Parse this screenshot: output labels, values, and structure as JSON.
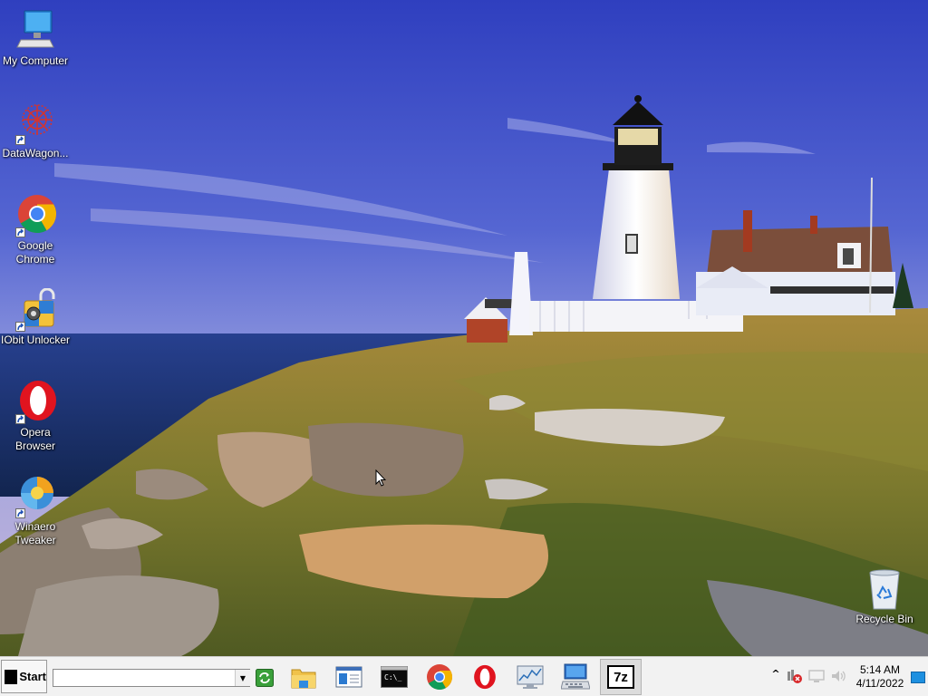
{
  "desktop": {
    "icons": [
      {
        "label": "My Computer",
        "icon": "computer-icon",
        "shortcut": false
      },
      {
        "label": "DataWagon...",
        "icon": "datawagon-icon",
        "shortcut": true
      },
      {
        "label": "Google Chrome",
        "icon": "chrome-icon",
        "shortcut": true
      },
      {
        "label": "IObit Unlocker",
        "icon": "iobit-unlocker-icon",
        "shortcut": true
      },
      {
        "label": "Opera Browser",
        "icon": "opera-icon",
        "shortcut": true
      },
      {
        "label": "Winaero Tweaker",
        "icon": "winaero-icon",
        "shortcut": true
      },
      {
        "label": "Recycle Bin",
        "icon": "recycle-bin-icon",
        "shortcut": false
      }
    ],
    "wallpaper": "lighthouse-coast-wallpaper"
  },
  "taskbar": {
    "start_label": "Start",
    "address_value": "",
    "pinned": [
      {
        "name": "file-explorer",
        "icon": "folder-icon"
      },
      {
        "name": "control-panel",
        "icon": "window-panel-icon"
      },
      {
        "name": "command-prompt",
        "icon": "cmd-icon"
      },
      {
        "name": "google-chrome",
        "icon": "chrome-icon"
      },
      {
        "name": "opera",
        "icon": "opera-icon"
      },
      {
        "name": "performance-monitor",
        "icon": "monitor-chart-icon"
      },
      {
        "name": "remote-desktop",
        "icon": "remote-desktop-icon"
      },
      {
        "name": "7-zip",
        "icon": "7zip-icon",
        "active": true
      }
    ],
    "sevenzip_label": "7z",
    "tray": {
      "chevron": "^",
      "icons": [
        "network-error-icon",
        "display-icon",
        "volume-icon"
      ]
    },
    "clock": {
      "time": "5:14 AM",
      "date": "4/11/2022"
    }
  },
  "colors": {
    "taskbar_bg": "#f2f2f2",
    "sky_top": "#3a49c4",
    "sea": "#1f3f8c",
    "accent_blue": "#1e90e0"
  }
}
